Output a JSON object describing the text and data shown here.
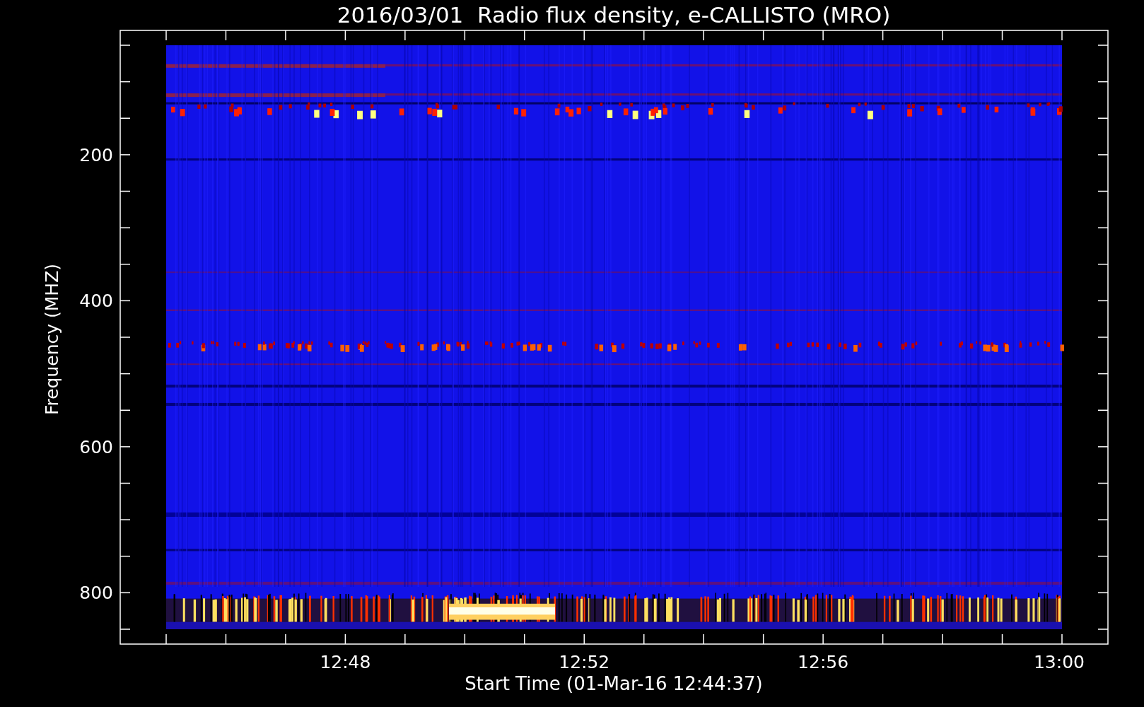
{
  "title": "2016/03/01  Radio flux density, e-CALLISTO (MRO)",
  "y_axis": {
    "label": "Frequency (MHZ)",
    "ticks": [
      "200",
      "400",
      "600",
      "800"
    ]
  },
  "x_axis": {
    "label": "Start Time (01-Mar-16 12:44:37)",
    "ticks": [
      "12:48",
      "12:52",
      "12:56",
      "13:00"
    ]
  }
}
